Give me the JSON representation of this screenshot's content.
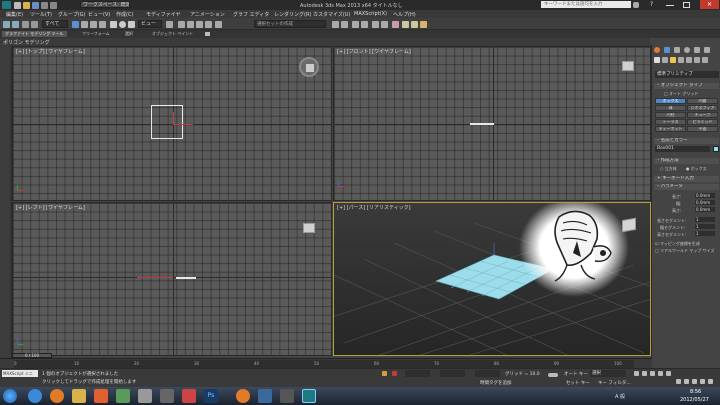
{
  "window": {
    "tab_label": "ワークスペース: 既定",
    "title": "Autodesk 3ds Max 2013 x64   タイトルなし",
    "search_placeholder": "キーワードまたは語句を入力"
  },
  "menus": [
    "編集(E)",
    "ツール(T)",
    "グループ(G)",
    "ビュー(V)",
    "作成(C)",
    "モディファイヤ",
    "アニメーション",
    "グラフ エディタ",
    "レンダリング(R)",
    "カスタマイズ(U)",
    "MAXScript(X)",
    "ヘルプ(H)"
  ],
  "toolbar": {
    "filter_select": "すべて",
    "view_select": "ビュー",
    "selection_set": "選択セットの作成"
  },
  "ribbon": {
    "label": "ポリゴン モデリング",
    "tabs": [
      "グラファイト モデリング ツール",
      "フリーフォーム",
      "選択",
      "オブジェクト ペイント"
    ]
  },
  "viewports": {
    "top_label": "[+] [トップ] [ワイヤフレーム]",
    "front_label": "[+] [フロント] [ワイヤフレーム]",
    "left_label": "[+] [レフト] [ワイヤフレーム]",
    "persp_label": "[+] [パース] [リアリスティック]"
  },
  "command_panel": {
    "category": "標準プリミティブ",
    "object_type_header": "オブジェクト タイプ",
    "autogrid": "オート グリッド",
    "object_buttons": [
      "ボックス",
      "円錐",
      "球",
      "ジオスフィア",
      "円柱",
      "チューブ",
      "トーラス",
      "ピラミッド",
      "ティーポット",
      "平面"
    ],
    "active_button": 0,
    "name_color_header": "名前とカラー",
    "object_name": "Box001",
    "create_method_header": "作成方法",
    "create_method_options": [
      "立方体",
      "ボックス"
    ],
    "keyboard_entry_header": "キーボード入力",
    "params_header": "パラメータ",
    "params": [
      {
        "label": "長さ:",
        "value": "0.0mm"
      },
      {
        "label": "幅:",
        "value": "0.0mm"
      },
      {
        "label": "高さ:",
        "value": "0.0mm"
      },
      {
        "label": "長さセグメント:",
        "value": "1"
      },
      {
        "label": "幅セグメント:",
        "value": "1"
      },
      {
        "label": "高さセグメント:",
        "value": "1"
      }
    ],
    "check_mapping": "マッピング座標を生成",
    "check_realworld": "リアルワールド マップ サイズ"
  },
  "timeline": {
    "frame_display": "0 / 100",
    "ticks": [
      "0",
      "10",
      "20",
      "30",
      "40",
      "50",
      "60",
      "70",
      "80",
      "90",
      "100"
    ]
  },
  "status": {
    "maxscript_label": "MAXScript ミニ",
    "line1": "1 個のオブジェクトが選択されました",
    "line2": "クリックしてドラッグで作成処理を開始します",
    "grid_label": "グリッド = 10.0",
    "add_time_tag": "時間タグを追加",
    "autokey": "オート キー",
    "set_key": "セット キー",
    "selected": "選択",
    "key_filter": "キー フィルタ..."
  },
  "taskbar": {
    "time": "8:56",
    "date": "2012/05/27",
    "lang": "A 般"
  },
  "colors": {
    "accent_blue": "#4b87c7",
    "persp_border": "#b89d2f",
    "plane_fill": "#9ddcea",
    "box_outline": "#e8e8e8",
    "axis_red": "#c23a3a"
  }
}
